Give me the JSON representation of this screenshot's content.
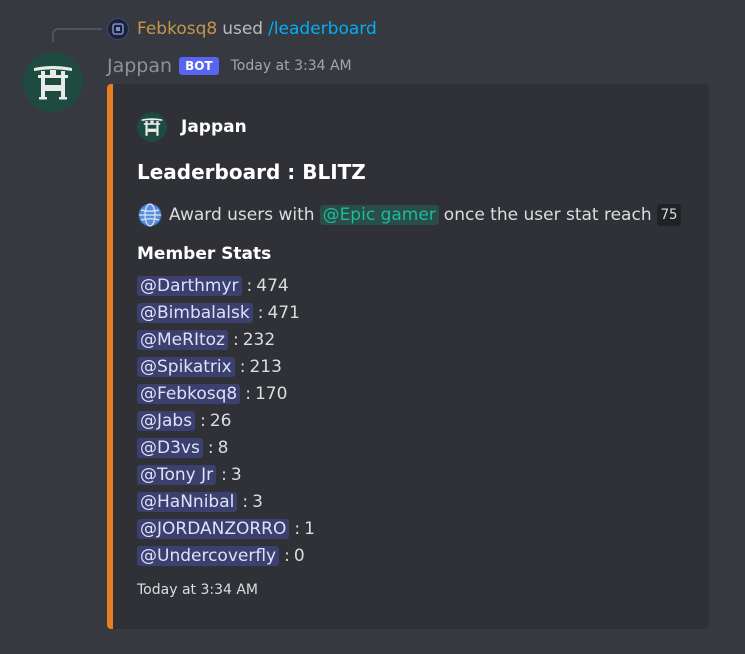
{
  "reply": {
    "user": "Febkosq8",
    "used": "used",
    "command": "/leaderboard"
  },
  "author": {
    "name": "Jappan",
    "bot_tag": "BOT",
    "timestamp": "Today at 3:34 AM"
  },
  "embed": {
    "color": "#e67e22",
    "author_name": "Jappan",
    "title": "Leaderboard : BLITZ",
    "description": {
      "prefix": "Award users with",
      "role": "@Epic gamer",
      "middle": "once the user stat reach",
      "threshold": "75"
    },
    "field_name": "Member Stats",
    "separator": ":",
    "stats": [
      {
        "user": "@Darthmyr",
        "value": "474"
      },
      {
        "user": "@Bimbalalsk",
        "value": "471"
      },
      {
        "user": "@MeRItoz",
        "value": "232"
      },
      {
        "user": "@Spikatrix",
        "value": "213"
      },
      {
        "user": "@Febkosq8",
        "value": "170"
      },
      {
        "user": "@Jabs",
        "value": "26"
      },
      {
        "user": "@D3vs",
        "value": "8"
      },
      {
        "user": "@Tony Jr",
        "value": "3"
      },
      {
        "user": "@HaNnibal",
        "value": "3"
      },
      {
        "user": "@JORDANZORRO",
        "value": "1"
      },
      {
        "user": "@Undercoverfly",
        "value": "0"
      }
    ],
    "footer": "Today at 3:34 AM"
  },
  "icons": {
    "reply_avatar": "user-avatar-icon",
    "bot_avatar": "torii-gate-icon",
    "description": "globe-icon"
  }
}
